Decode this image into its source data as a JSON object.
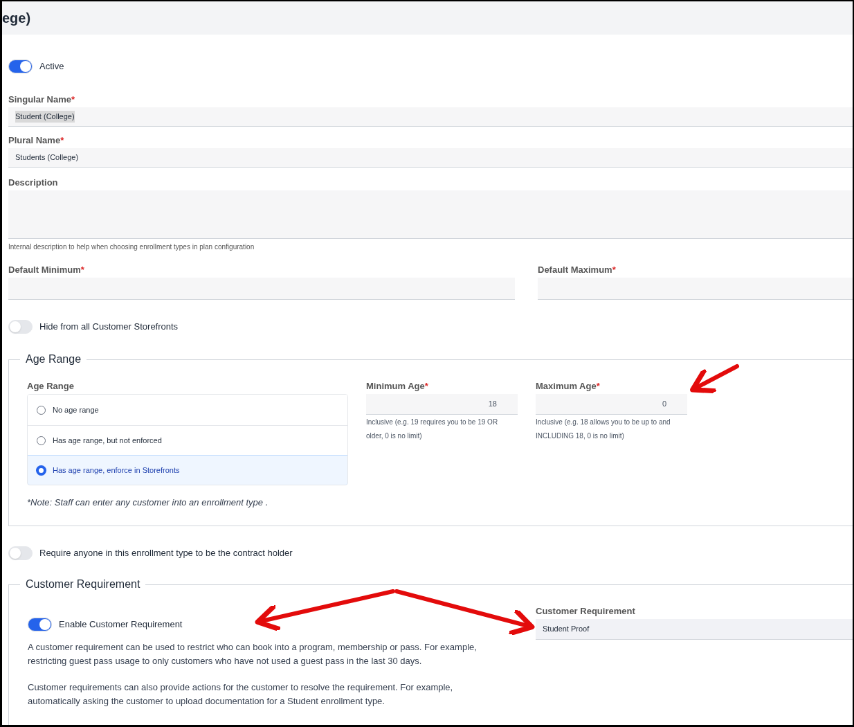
{
  "header": {
    "title": "ege)"
  },
  "active_toggle": {
    "label": "Active",
    "on": true
  },
  "singular_name": {
    "label": "Singular Name",
    "required_mark": "*",
    "value": "Student (College)",
    "text_selected": true
  },
  "plural_name": {
    "label": "Plural Name",
    "required_mark": "*",
    "value": "Students (College)",
    "text_selected": false
  },
  "description": {
    "label": "Description",
    "help": "Internal description to help when choosing enrollment types in plan configuration"
  },
  "defaults": [
    {
      "label": "Default Minimum",
      "required_mark": "*"
    },
    {
      "label": "Default Maximum",
      "required_mark": "*"
    }
  ],
  "hide_toggle": {
    "label": "Hide from all Customer Storefronts",
    "on": false
  },
  "age_range": {
    "legend": "Age Range",
    "label": "Age Range",
    "options": [
      {
        "label": "No age range",
        "selected": false
      },
      {
        "label": "Has age range, but not enforced",
        "selected": false
      },
      {
        "label": "Has age range, enforce in Storefronts",
        "selected": true
      }
    ],
    "note": "*Note: Staff can enter any customer into an enrollment type .",
    "limits": [
      {
        "label": "Minimum Age",
        "required_mark": "*",
        "value": "18",
        "help": "Inclusive (e.g. 19 requires you to be 19 OR older, 0 is no limit)"
      },
      {
        "label": "Maximum Age",
        "required_mark": "*",
        "value": "0",
        "help": "Inclusive (e.g. 18 allows you to be up to and INCLUDING 18, 0 is no limit)"
      }
    ]
  },
  "contract_toggle": {
    "label": "Require anyone in this enrollment type to be the contract holder",
    "on": false
  },
  "customer_requirement": {
    "legend": "Customer Requirement",
    "toggle": {
      "label": "Enable Customer Requirement",
      "on": true
    },
    "paragraphs": [
      "A customer requirement can be used to restrict who can book into a program, membership or pass. For example, restricting guest pass usage to only customers who have not used a guest pass in the last 30 days.",
      "Customer requirements can also provide actions for the customer to resolve the requirement. For example, automatically asking the customer to upload documentation for a Student enrollment type."
    ],
    "field": {
      "label": "Customer Requirement",
      "value": "Student Proof"
    }
  }
}
